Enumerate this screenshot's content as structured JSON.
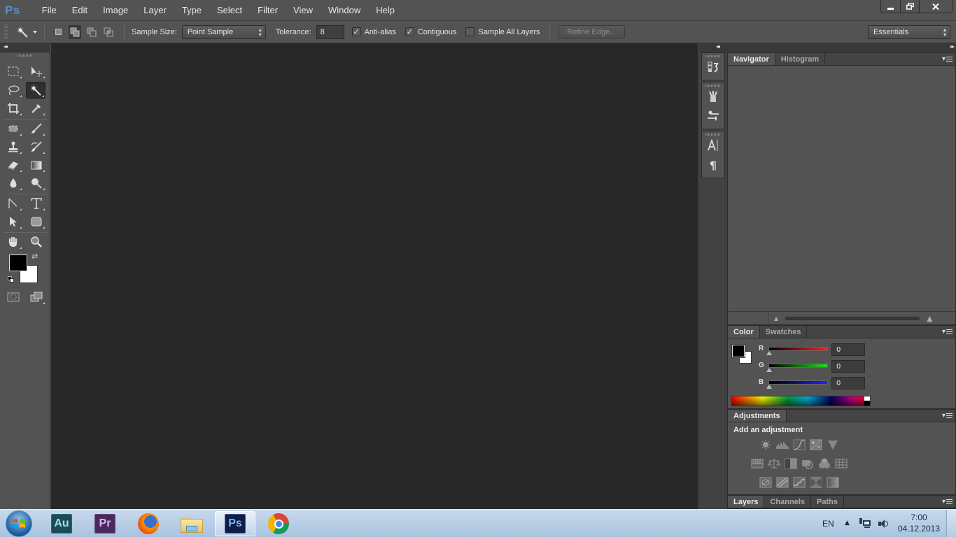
{
  "app": {
    "logo": "Ps",
    "name": "Adobe Photoshop"
  },
  "menu": [
    "File",
    "Edit",
    "Image",
    "Layer",
    "Type",
    "Select",
    "Filter",
    "View",
    "Window",
    "Help"
  ],
  "window_controls": {
    "minimize": "minimize",
    "restore": "restore",
    "close": "close"
  },
  "options_bar": {
    "tool_icon": "magic-wand-icon",
    "selection_modes": [
      "new-selection",
      "add-to-selection",
      "subtract-from-selection",
      "intersect-with-selection"
    ],
    "active_selection_mode": "add-to-selection",
    "sample_size_label": "Sample Size:",
    "sample_size_value": "Point Sample",
    "tolerance_label": "Tolerance:",
    "tolerance_value": "8",
    "anti_alias_label": "Anti-alias",
    "anti_alias_checked": true,
    "contiguous_label": "Contiguous",
    "contiguous_checked": true,
    "sample_all_layers_label": "Sample All Layers",
    "sample_all_layers_checked": false,
    "refine_edge_label": "Refine Edge...",
    "workspace_value": "Essentials"
  },
  "toolbox": {
    "active_tool": "magic-wand",
    "tools": [
      "rectangular-marquee",
      "move",
      "lasso",
      "magic-wand",
      "crop",
      "eyedropper",
      "spot-healing",
      "brush",
      "clone-stamp",
      "history-brush",
      "eraser",
      "gradient",
      "blur",
      "dodge",
      "pen",
      "type",
      "path-selection",
      "rectangle-shape",
      "hand",
      "zoom"
    ],
    "foreground_color": "#000000",
    "background_color": "#ffffff"
  },
  "dock_icons": [
    "history",
    "brushes",
    "brush-presets",
    "character",
    "paragraph"
  ],
  "navigator_panel": {
    "tabs": [
      "Navigator",
      "Histogram"
    ],
    "active_tab": "Navigator"
  },
  "color_panel": {
    "tabs": [
      "Color",
      "Swatches"
    ],
    "active_tab": "Color",
    "channels": [
      {
        "label": "R",
        "value": "0",
        "color": "#ff2020"
      },
      {
        "label": "G",
        "value": "0",
        "color": "#20dd20"
      },
      {
        "label": "B",
        "value": "0",
        "color": "#2020ff"
      }
    ]
  },
  "adjustments_panel": {
    "tabs": [
      "Adjustments"
    ],
    "heading": "Add an adjustment",
    "rows": [
      [
        "brightness-contrast",
        "levels",
        "curves",
        "exposure",
        "vibrance"
      ],
      [
        "hue-saturation",
        "color-balance",
        "black-white",
        "photo-filter",
        "channel-mixer",
        "color-lookup"
      ],
      [
        "invert",
        "posterize",
        "threshold",
        "selective-color",
        "gradient-map"
      ]
    ]
  },
  "layers_panel": {
    "tabs": [
      "Layers",
      "Channels",
      "Paths"
    ],
    "active_tab": "Layers"
  },
  "taskbar": {
    "apps": [
      {
        "name": "Audition",
        "label": "Au",
        "bg": "#1d4b55",
        "fg": "#9ee0ea"
      },
      {
        "name": "Premiere Pro",
        "label": "Pr",
        "bg": "#4a2a5e",
        "fg": "#d6b6f0"
      },
      {
        "name": "Firefox",
        "label": "",
        "bg": "",
        "fg": ""
      },
      {
        "name": "Windows Explorer",
        "label": "",
        "bg": "",
        "fg": ""
      },
      {
        "name": "Photoshop",
        "label": "Ps",
        "bg": "#0e1d4a",
        "fg": "#7ab4f0"
      },
      {
        "name": "Chrome",
        "label": "",
        "bg": "",
        "fg": ""
      }
    ],
    "active_app": "Photoshop",
    "language": "EN",
    "time": "7:00",
    "date": "04.12.2013"
  }
}
